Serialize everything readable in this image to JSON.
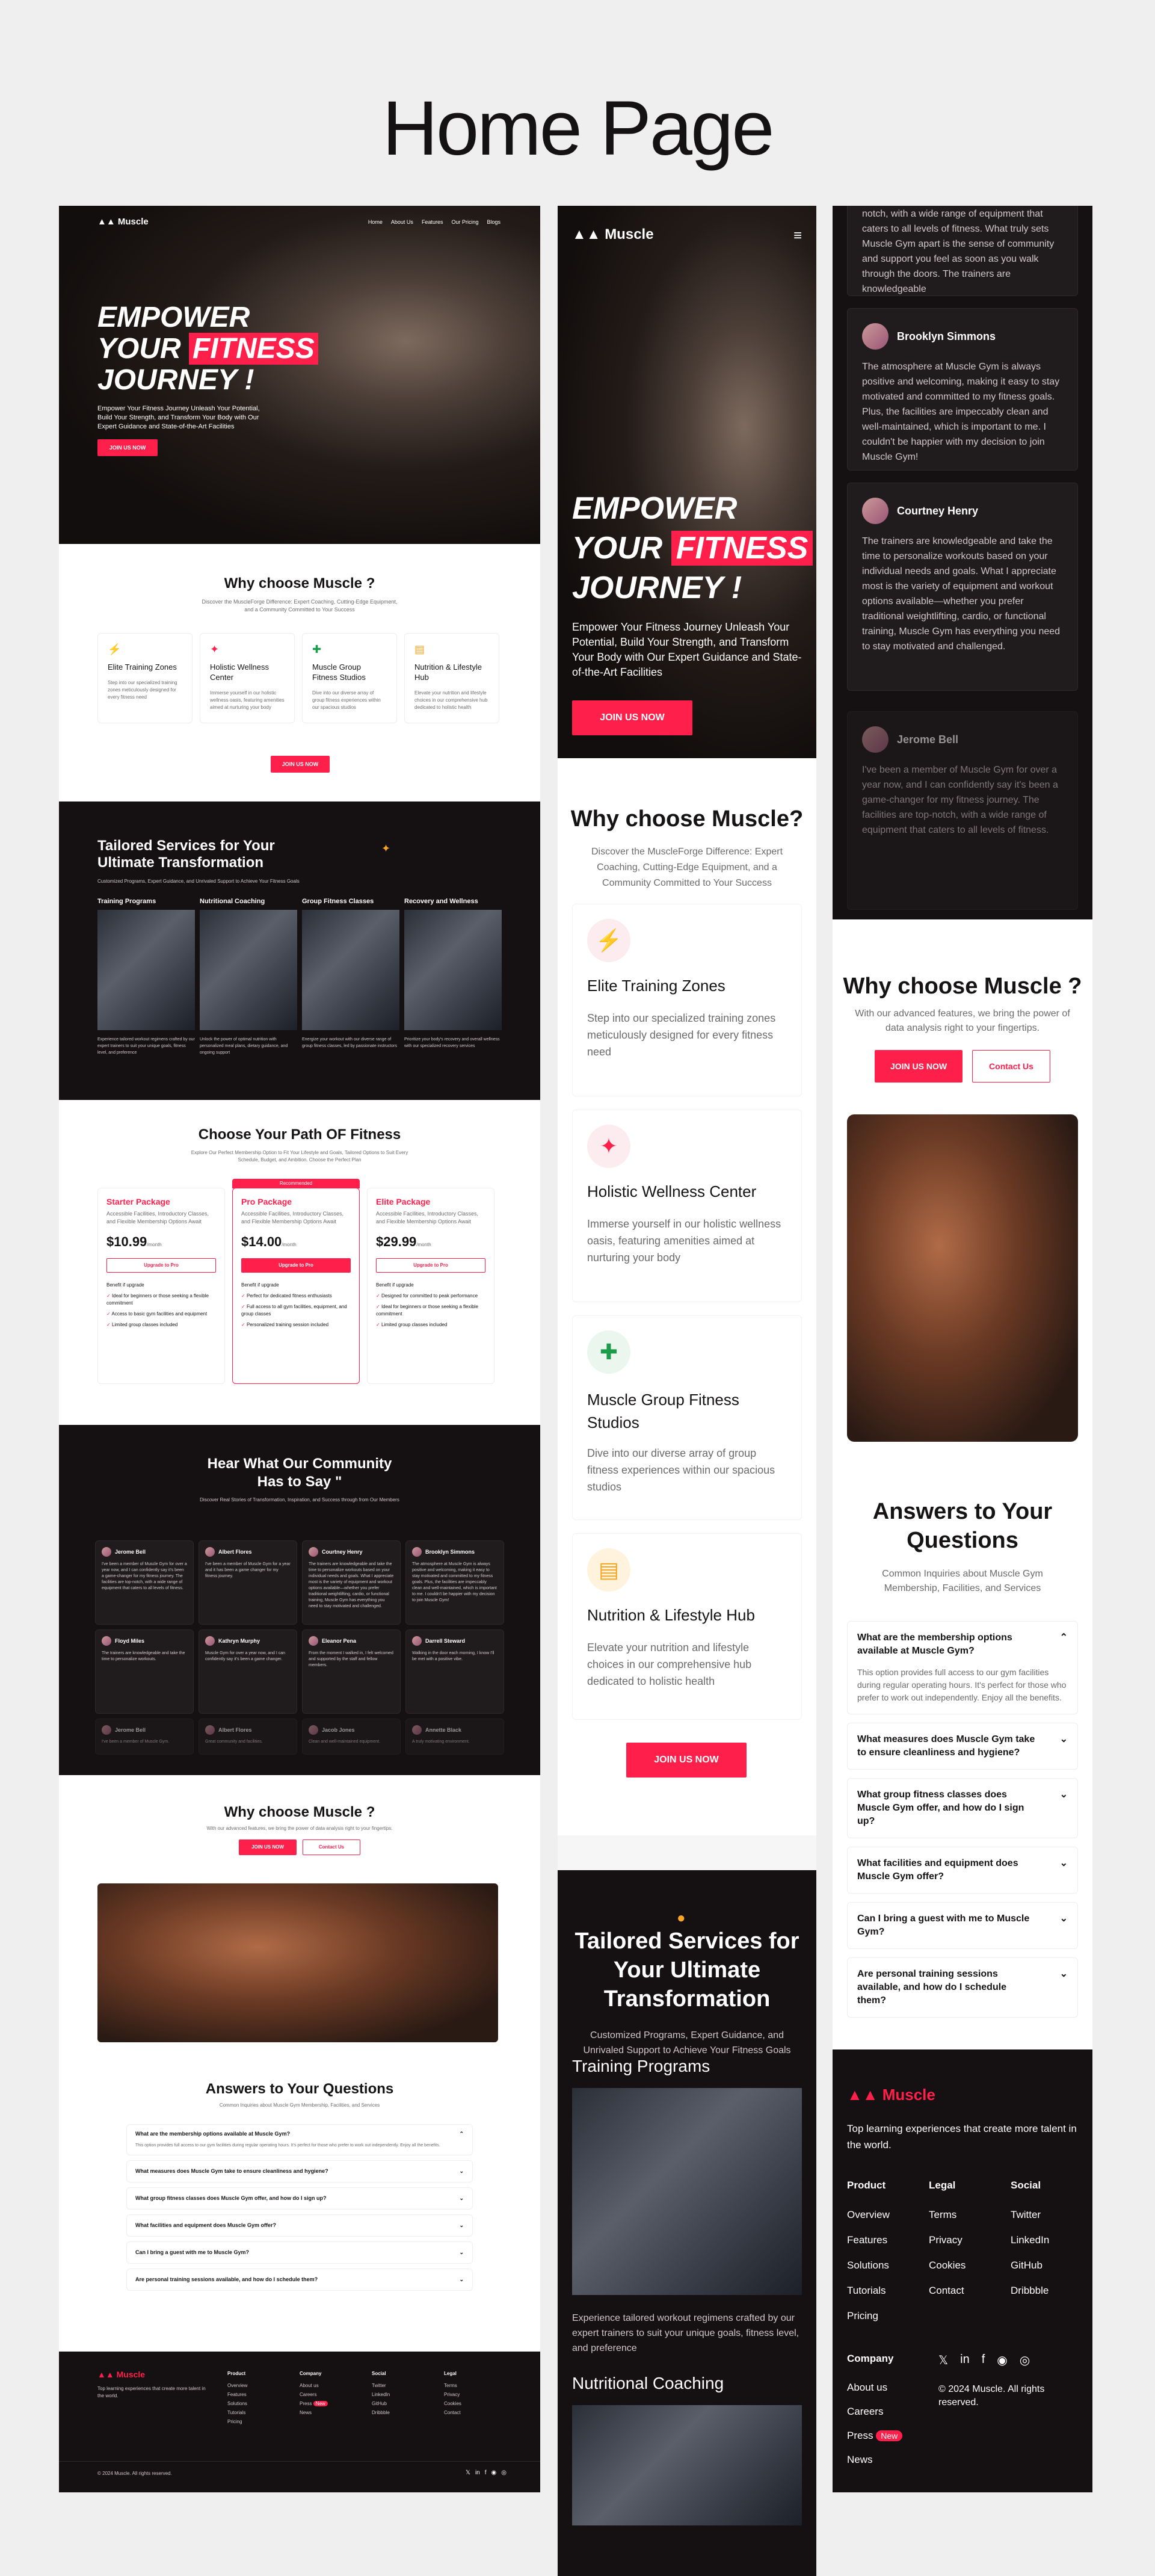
{
  "page_title": "Home Page",
  "brand": "Muscle",
  "colors": {
    "accent": "#ff1f4b",
    "dark": "#151012",
    "bg": "#efefef"
  },
  "nav": [
    "Home",
    "About Us",
    "Features",
    "Our Pricing",
    "Blogs"
  ],
  "hero": {
    "line1": "EMPOWER",
    "line2a": "YOUR ",
    "line2b": "FITNESS",
    "line3": "JOURNEY !",
    "desc": "Empower Your Fitness Journey Unleash Your Potential, Build Your Strength, and Transform Your Body with Our Expert Guidance and State-of-the-Art Facilities",
    "cta": "JOIN US NOW"
  },
  "why": {
    "title": "Why choose Muscle ?",
    "title_m": "Why choose Muscle?",
    "desc": "Discover the MuscleForge Difference: Expert Coaching, Cutting-Edge Equipment, and a Community Committed to Your Success",
    "cta": "JOIN US NOW",
    "features": [
      {
        "icon": "bolt-icon",
        "title": "Elite Training Zones",
        "desc": "Step into our specialized training zones meticulously designed for every fitness need"
      },
      {
        "icon": "sparkle-icon",
        "title": "Holistic Wellness Center",
        "desc": "Immerse yourself in our holistic wellness oasis, featuring amenities aimed at nurturing your body"
      },
      {
        "icon": "puzzle-icon",
        "title": "Muscle Group Fitness Studios",
        "desc": "Dive into our diverse array of group fitness experiences within our spacious studios"
      },
      {
        "icon": "document-icon",
        "title": "Nutrition & Lifestyle Hub",
        "desc": "Elevate your nutrition and lifestyle choices in our comprehensive hub dedicated to holistic health"
      }
    ]
  },
  "services": {
    "title": "Tailored Services for Your Ultimate Transformation",
    "desc": "Customized Programs, Expert Guidance, and Unrivaled Support to Achieve Your Fitness Goals",
    "items": [
      {
        "title": "Training Programs",
        "desc": "Experience tailored workout regimens crafted by our expert trainers to suit your unique goals, fitness level, and preference"
      },
      {
        "title": "Nutritional Coaching",
        "desc": "Unlock the power of optimal nutrition with personalized meal plans, dietary guidance, and ongoing support"
      },
      {
        "title": "Group Fitness Classes",
        "desc": "Energize your workout with our diverse range of group fitness classes, led by passionate instructors"
      },
      {
        "title": "Recovery and Wellness",
        "desc": "Prioritize your body's recovery and overall wellness with our specialized recovery services"
      }
    ]
  },
  "pricing": {
    "title": "Choose Your Path OF Fitness",
    "desc": "Explore Our Perfect Membership Option to Fit Your Lifestyle and Goals, Tailored Options to Suit Every Schedule, Budget, and Ambition. Choose the Perfect Plan",
    "badge": "Recommended",
    "benefits_label": "Benefit if upgrade",
    "period": "/month",
    "plans": [
      {
        "name": "Starter Package",
        "desc": "Accessible Facilities, Introductory Classes, and Flexible Membership Options Await",
        "price": "$10.99",
        "cta": "Upgrade to Pro",
        "benefits": [
          "Ideal for beginners or those seeking a flexible commitment",
          "Access to basic gym facilities and equipment",
          "Limited group classes included"
        ]
      },
      {
        "name": "Pro Package",
        "desc": "Accessible Facilities, Introductory Classes, and Flexible Membership Options Await",
        "price": "$14.00",
        "cta": "Upgrade to Pro",
        "benefits": [
          "Perfect for dedicated fitness enthusiasts",
          "Full access to all gym facilities, equipment, and group classes",
          "Personalized training session included"
        ]
      },
      {
        "name": "Elite Package",
        "desc": "Accessible Facilities, Introductory Classes, and Flexible Membership Options Await",
        "price": "$29.99",
        "cta": "Upgrade to Pro",
        "benefits": [
          "Designed for committed to peak performance",
          "Ideal for beginners or those seeking a flexible commitment",
          "Limited group classes included"
        ]
      }
    ]
  },
  "testimonials": {
    "title": "Hear What Our Community Has to Say \"",
    "desc": "Discover Real Stories of Transformation, Inspiration, and Success through from Our Members",
    "items": [
      {
        "name": "Jerome Bell",
        "text": "I've been a member of Muscle Gym for over a year now, and I can confidently say it's been a game-changer for my fitness journey. The facilities are top-notch, with a wide range of equipment that caters to all levels of fitness."
      },
      {
        "name": "Albert Flores",
        "text": "I've been a member of Muscle Gym for a year and it has been a game changer for my fitness journey."
      },
      {
        "name": "Courtney Henry",
        "text": "The trainers are knowledgeable and take the time to personalize workouts based on your individual needs and goals. What I appreciate most is the variety of equipment and workout options available—whether you prefer traditional weightlifting, cardio, or functional training, Muscle Gym has everything you need to stay motivated and challenged."
      },
      {
        "name": "Brooklyn Simmons",
        "text": "The atmosphere at Muscle Gym is always positive and welcoming, making it easy to stay motivated and committed to my fitness goals. Plus, the facilities are impeccably clean and well-maintained, which is important to me. I couldn't be happier with my decision to join Muscle Gym!"
      },
      {
        "name": "Floyd Miles",
        "text": "The trainers are knowledgeable and take the time to personalize workouts."
      },
      {
        "name": "Kathryn Murphy",
        "text": "Muscle Gym for over a year now, and I can confidently say it's been a game changer."
      },
      {
        "name": "Eleanor Pena",
        "text": "From the moment I walked in, I felt welcomed and supported by the staff and fellow members."
      },
      {
        "name": "Darrell Steward",
        "text": "Walking in the door each morning, I know I'll be met with a positive vibe."
      },
      {
        "name": "Jerome Bell",
        "text": "I've been a member of Muscle Gym."
      },
      {
        "name": "Albert Flores",
        "text": "Great community and facilities."
      },
      {
        "name": "Jacob Jones",
        "text": "Clean and well-maintained equipment."
      },
      {
        "name": "Annette Black",
        "text": "A truly motivating environment."
      }
    ],
    "right_top": "notch, with a wide range of equipment that caters to all levels of fitness. What truly sets Muscle Gym apart is the sense of community and support you feel as soon as you walk through the doors. The trainers are knowledgeable"
  },
  "why2": {
    "title": "Why choose Muscle ?",
    "desc": "With our advanced features, we bring the power of data analysis right to your fingertips.",
    "cta": "JOIN US NOW",
    "cta2": "Contact Us"
  },
  "faq": {
    "title": "Answers to Your Questions",
    "desc": "Common Inquiries about Muscle Gym Membership, Facilities, and Services",
    "items": [
      {
        "q": "What are the membership options available at Muscle Gym?",
        "a": "This option provides full access to our gym facilities during regular operating hours. It's perfect for those who prefer to work out independently. Enjoy all the benefits."
      },
      {
        "q": "What measures does Muscle Gym take to ensure cleanliness and hygiene?"
      },
      {
        "q": "What group fitness classes does Muscle Gym offer, and how do I sign up?"
      },
      {
        "q": "What facilities and equipment does Muscle Gym offer?"
      },
      {
        "q": "Can I bring a guest with me to Muscle Gym?"
      },
      {
        "q": "Are personal training sessions available, and how do I schedule them?"
      }
    ]
  },
  "footer": {
    "tagline": "Top learning experiences that create more talent in the world.",
    "copyright": "© 2024 Muscle. All rights reserved.",
    "new": "New",
    "cols": [
      {
        "title": "Product",
        "links": [
          "Overview",
          "Features",
          "Solutions",
          "Tutorials",
          "Pricing"
        ]
      },
      {
        "title": "Company",
        "links": [
          "About us",
          "Careers",
          "Press",
          "News"
        ]
      },
      {
        "title": "Social",
        "links": [
          "Twitter",
          "LinkedIn",
          "GitHub",
          "Dribbble"
        ]
      },
      {
        "title": "Legal",
        "links": [
          "Terms",
          "Privacy",
          "Cookies",
          "Contact"
        ]
      }
    ]
  }
}
